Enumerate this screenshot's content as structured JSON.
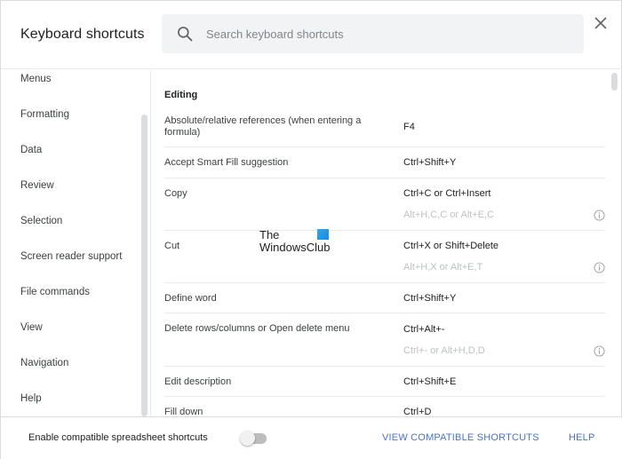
{
  "dialog": {
    "title": "Keyboard shortcuts",
    "search": {
      "placeholder": "Search keyboard shortcuts",
      "value": ""
    },
    "close_icon": "close-icon"
  },
  "sidebar": {
    "items": [
      {
        "label": "Menus"
      },
      {
        "label": "Formatting"
      },
      {
        "label": "Data"
      },
      {
        "label": "Review"
      },
      {
        "label": "Selection"
      },
      {
        "label": "Screen reader support"
      },
      {
        "label": "File commands"
      },
      {
        "label": "View"
      },
      {
        "label": "Navigation"
      },
      {
        "label": "Help"
      }
    ]
  },
  "content": {
    "section_title": "Editing",
    "shortcuts": [
      {
        "description": "Absolute/relative references (when entering a formula)",
        "shortcut": "F4",
        "alt_shortcut": null
      },
      {
        "description": "Accept Smart Fill suggestion",
        "shortcut": "Ctrl+Shift+Y",
        "alt_shortcut": null
      },
      {
        "description": "Copy",
        "shortcut": "Ctrl+C or Ctrl+Insert",
        "alt_shortcut": "Alt+H,C,C or Alt+E,C"
      },
      {
        "description": "Cut",
        "shortcut": "Ctrl+X or Shift+Delete",
        "alt_shortcut": "Alt+H,X or Alt+E,T"
      },
      {
        "description": "Define word",
        "shortcut": "Ctrl+Shift+Y",
        "alt_shortcut": null
      },
      {
        "description": "Delete rows/columns or Open delete menu",
        "shortcut": "Ctrl+Alt+-",
        "alt_shortcut": "Ctrl+- or Alt+H,D,D"
      },
      {
        "description": "Edit description",
        "shortcut": "Ctrl+Shift+E",
        "alt_shortcut": null
      },
      {
        "description": "Fill down",
        "shortcut": "Ctrl+D",
        "alt_shortcut": null
      }
    ]
  },
  "watermark": {
    "line1": "The",
    "line2": "WindowsClub"
  },
  "footer": {
    "toggle_label": "Enable compatible spreadsheet shortcuts",
    "toggle_on": false,
    "view_compatible_label": "VIEW COMPATIBLE SHORTCUTS",
    "help_label": "HELP"
  },
  "colors": {
    "link": "#4a72cf",
    "muted_text": "#bdc1c6",
    "search_bg": "#f1f3f4"
  }
}
